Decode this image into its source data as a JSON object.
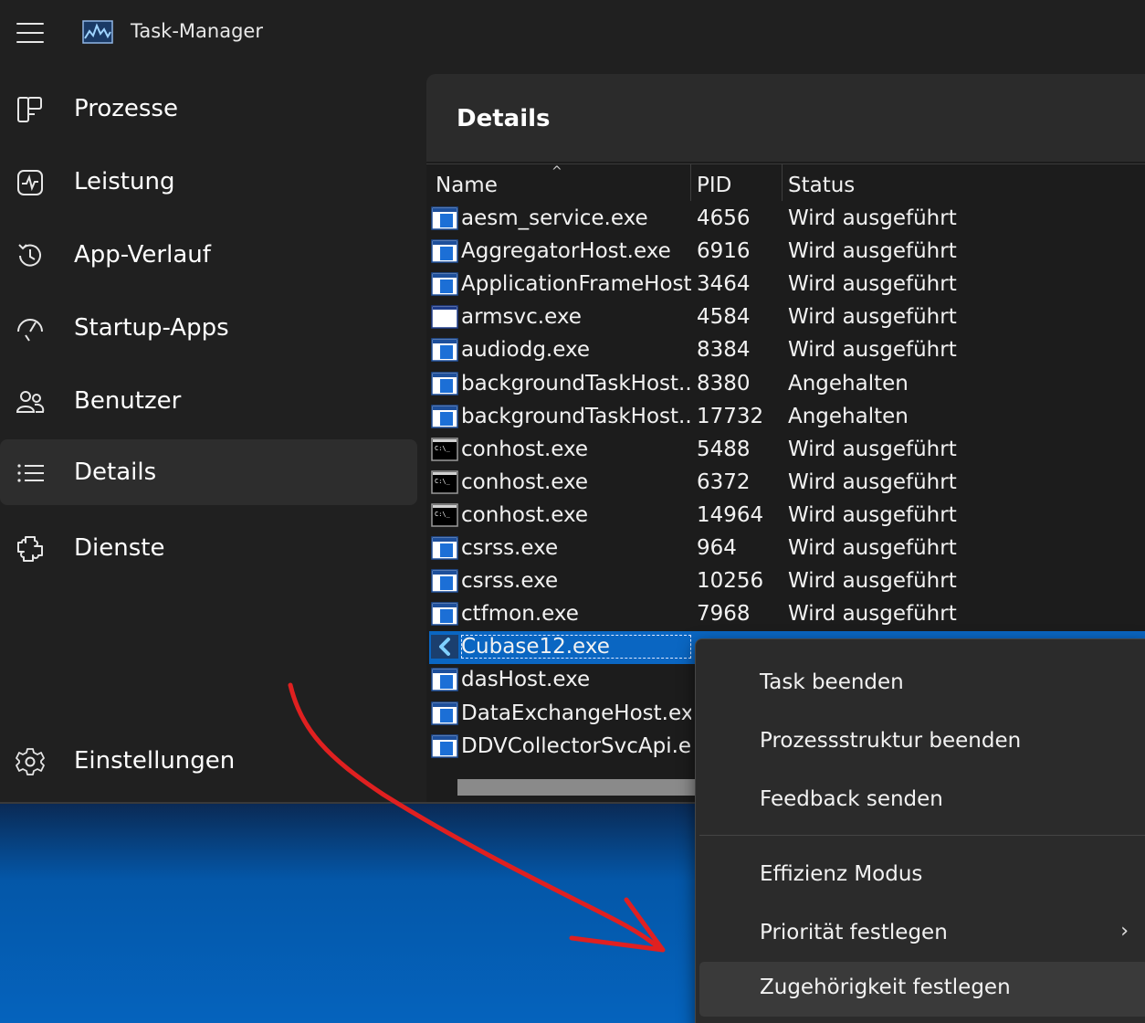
{
  "window": {
    "title": "Task-Manager"
  },
  "sidebar": {
    "items": [
      {
        "label": "Prozesse",
        "icon": "processes-icon"
      },
      {
        "label": "Leistung",
        "icon": "performance-icon"
      },
      {
        "label": "App-Verlauf",
        "icon": "history-icon"
      },
      {
        "label": "Startup-Apps",
        "icon": "startup-icon"
      },
      {
        "label": "Benutzer",
        "icon": "users-icon"
      },
      {
        "label": "Details",
        "icon": "details-list-icon",
        "selected": true
      },
      {
        "label": "Dienste",
        "icon": "services-icon"
      }
    ],
    "settings_label": "Einstellungen"
  },
  "main": {
    "title": "Details",
    "columns": [
      "Name",
      "PID",
      "Status"
    ],
    "rows": [
      {
        "name": "aesm_service.exe",
        "pid": "4656",
        "status": "Wird ausgeführt",
        "icon": "window-app-icon"
      },
      {
        "name": "AggregatorHost.exe",
        "pid": "6916",
        "status": "Wird ausgeführt",
        "icon": "window-app-icon"
      },
      {
        "name": "ApplicationFrameHost...",
        "pid": "3464",
        "status": "Wird ausgeführt",
        "icon": "window-app-icon"
      },
      {
        "name": "armsvc.exe",
        "pid": "4584",
        "status": "Wird ausgeführt",
        "icon": "blank-window-icon"
      },
      {
        "name": "audiodg.exe",
        "pid": "8384",
        "status": "Wird ausgeführt",
        "icon": "window-app-icon"
      },
      {
        "name": "backgroundTaskHost....",
        "pid": "8380",
        "status": "Angehalten",
        "icon": "window-app-icon"
      },
      {
        "name": "backgroundTaskHost....",
        "pid": "17732",
        "status": "Angehalten",
        "icon": "window-app-icon"
      },
      {
        "name": "conhost.exe",
        "pid": "5488",
        "status": "Wird ausgeführt",
        "icon": "console-icon"
      },
      {
        "name": "conhost.exe",
        "pid": "6372",
        "status": "Wird ausgeführt",
        "icon": "console-icon"
      },
      {
        "name": "conhost.exe",
        "pid": "14964",
        "status": "Wird ausgeführt",
        "icon": "console-icon"
      },
      {
        "name": "csrss.exe",
        "pid": "964",
        "status": "Wird ausgeführt",
        "icon": "window-app-icon"
      },
      {
        "name": "csrss.exe",
        "pid": "10256",
        "status": "Wird ausgeführt",
        "icon": "window-app-icon"
      },
      {
        "name": "ctfmon.exe",
        "pid": "7968",
        "status": "Wird ausgeführt",
        "icon": "window-app-icon"
      },
      {
        "name": "Cubase12.exe",
        "pid": "",
        "status": "",
        "icon": "cubase-icon",
        "selected": true
      },
      {
        "name": "dasHost.exe",
        "pid": "",
        "status": "",
        "icon": "window-app-icon"
      },
      {
        "name": "DataExchangeHost.exe",
        "pid": "",
        "status": "",
        "icon": "window-app-icon"
      },
      {
        "name": "DDVCollectorSvcApi.e...",
        "pid": "",
        "status": "",
        "icon": "window-app-icon"
      }
    ]
  },
  "context_menu": {
    "items": [
      {
        "label": "Task beenden"
      },
      {
        "label": "Prozessstruktur beenden"
      },
      {
        "label": "Feedback senden"
      },
      {
        "label": "Effizienz Modus"
      },
      {
        "label": "Priorität festlegen",
        "submenu": true
      },
      {
        "label": "Zugehörigkeit festlegen",
        "hover": true
      }
    ],
    "submenu_arrow": "›"
  },
  "colors": {
    "background": "#202020",
    "selection": "#0a66c2",
    "annotation": "#e02020"
  },
  "sort_indicator": "^"
}
